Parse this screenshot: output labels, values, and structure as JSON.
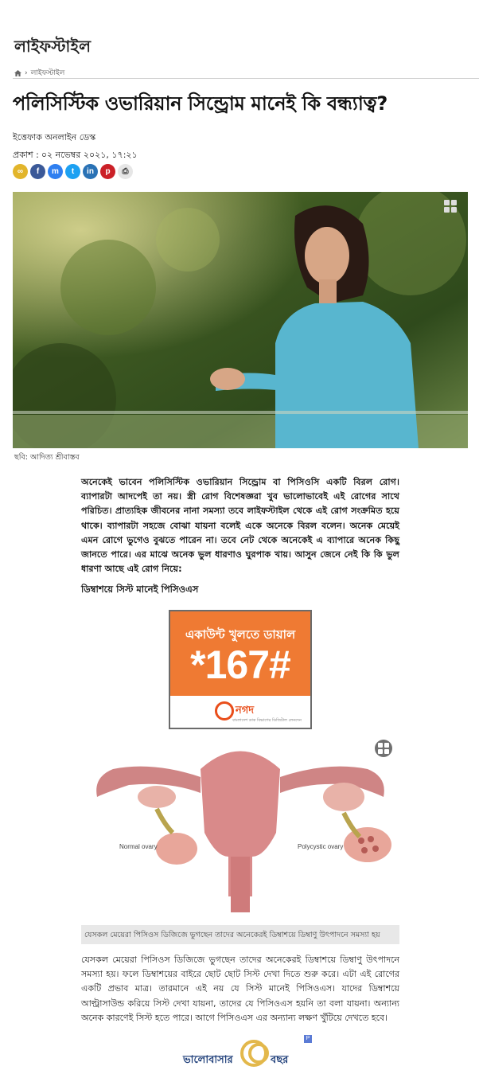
{
  "section": {
    "name": "লাইফস্টাইল"
  },
  "breadcrumb": {
    "home_icon": "home-icon",
    "current": "লাইফস্টাইল"
  },
  "article": {
    "headline": "পলিসিস্টিক ওভারিয়ান সিন্ড্রোম মানেই কি বন্ধ্যাত্ব?",
    "byline": "ইত্তেফাক অনলাইন ডেস্ক",
    "published_label": "প্রকাশ :",
    "published_value": "০২ নভেম্বর ২০২১, ১৭:২১",
    "hero_caption": "ছবি: আদিত্য শ্রীবাস্তব",
    "paragraph1": "অনেকেই ভাবেন পলিসিস্টিক ওভারিয়ান সিন্ড্রোম বা পিসিওসি একটি বিরল রোগ। ব্যাপারটা আদপেই তা নয়। স্ত্রী রোগ বিশেষজ্ঞরা খুব ভালোভাবেই এই রোগের সাথে পরিচিত। প্রাত্যহিক জীবনের নানা সমস্যা তবে লাইফস্টাইল থেকে এই রোগ সংক্রমিত হয়ে থাকে। ব্যাপারটা সহজে বোঝা যায়না বলেই একে অনেকে বিরল বলেন। অনেক মেয়েই এমন রোগে ভুগেও বুঝতে পারেন না। তবে নেট থেকে অনেকেই এ ব্যাপারে অনেক কিছু জানতে পারে। এর মাঝে অনেক ভুল ধারণাও ঘুরপাক খায়। আসুন জেনে নেই কি কি ভুল ধারণা আছে এই রোগ নিয়ে:",
    "subheading": "ডিম্বাশয়ে সিস্ট মানেই পিসিওএস",
    "image_caption": "যেসকল মেয়েরা পিসিওস ডিজিজে ভুগছেন তাদের অনেকেরই ডিম্বাশয়ে ডিম্বাণু উৎপাদনে সমস্যা হয়",
    "paragraph2": "যেসকল মেয়েরা পিসিওস ডিজিজে ভুগছেন তাদের অনেকেরই ডিম্বাশয়ে ডিম্বাণু উৎপাদনে সমস্যা হয়। ফলে ডিম্বাশয়ের বাইরে ছোট ছোট সিস্ট দেখা দিতে শুরু করে। এটা এই রোগের একটি প্রভাব মাত্র। তারমানে এই নয় যে সিস্ট মানেই পিসিওএস। যাদের ডিম্বাশয়ে আল্ট্রাসাউন্ড করিয়ে সিস্ট দেখা যায়না, তাদের যে পিসিওএস হয়নি তা বলা যায়না। অন্যান্য অনেক কারণেই সিস্ট হতে পারে। আগে পিসিওএস এর অন্যান্য লক্ষণ খুঁটিয়ে দেখতে হবে।"
  },
  "share": [
    {
      "icon": "link-icon",
      "glyph": "∞",
      "color": "#e2b52b"
    },
    {
      "icon": "facebook-icon",
      "glyph": "f",
      "color": "#3b5998"
    },
    {
      "icon": "messenger-icon",
      "glyph": "m",
      "color": "#2f7ff0"
    },
    {
      "icon": "twitter-icon",
      "glyph": "t",
      "color": "#1da1f2"
    },
    {
      "icon": "linkedin-icon",
      "glyph": "in",
      "color": "#2a72b5"
    },
    {
      "icon": "pinterest-icon",
      "glyph": "p",
      "color": "#cb2027"
    },
    {
      "icon": "print-icon",
      "glyph": "⎙",
      "color": "#e6e6e6"
    }
  ],
  "ad_nagad": {
    "line1": "একাউন্ট খুলতে ডায়াল",
    "code": "*167#",
    "brand": "নগদ",
    "tagline": "বাংলাদেশ ডাক বিভাগের ডিজিটাল লেনদেন"
  },
  "anatomy": {
    "label_left": "Normal ovary",
    "label_right": "Polycystic ovary"
  },
  "ad_bottom": {
    "text_left": "ভালোবাসার",
    "text_right": "বছর",
    "ad_tag": "P"
  }
}
